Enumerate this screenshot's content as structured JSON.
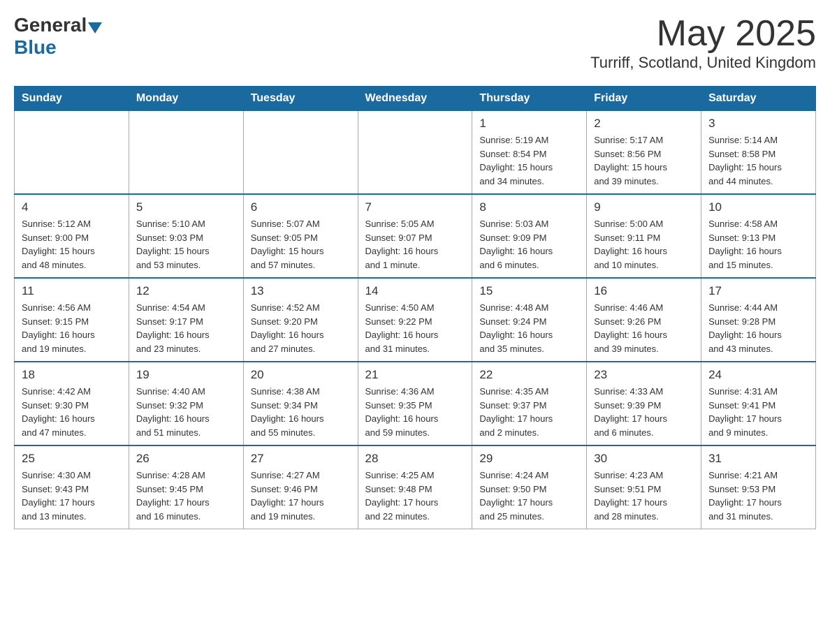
{
  "header": {
    "month_title": "May 2025",
    "location": "Turriff, Scotland, United Kingdom",
    "logo_general": "General",
    "logo_blue": "Blue"
  },
  "days_of_week": [
    "Sunday",
    "Monday",
    "Tuesday",
    "Wednesday",
    "Thursday",
    "Friday",
    "Saturday"
  ],
  "weeks": [
    [
      {
        "day": "",
        "info": ""
      },
      {
        "day": "",
        "info": ""
      },
      {
        "day": "",
        "info": ""
      },
      {
        "day": "",
        "info": ""
      },
      {
        "day": "1",
        "info": "Sunrise: 5:19 AM\nSunset: 8:54 PM\nDaylight: 15 hours\nand 34 minutes."
      },
      {
        "day": "2",
        "info": "Sunrise: 5:17 AM\nSunset: 8:56 PM\nDaylight: 15 hours\nand 39 minutes."
      },
      {
        "day": "3",
        "info": "Sunrise: 5:14 AM\nSunset: 8:58 PM\nDaylight: 15 hours\nand 44 minutes."
      }
    ],
    [
      {
        "day": "4",
        "info": "Sunrise: 5:12 AM\nSunset: 9:00 PM\nDaylight: 15 hours\nand 48 minutes."
      },
      {
        "day": "5",
        "info": "Sunrise: 5:10 AM\nSunset: 9:03 PM\nDaylight: 15 hours\nand 53 minutes."
      },
      {
        "day": "6",
        "info": "Sunrise: 5:07 AM\nSunset: 9:05 PM\nDaylight: 15 hours\nand 57 minutes."
      },
      {
        "day": "7",
        "info": "Sunrise: 5:05 AM\nSunset: 9:07 PM\nDaylight: 16 hours\nand 1 minute."
      },
      {
        "day": "8",
        "info": "Sunrise: 5:03 AM\nSunset: 9:09 PM\nDaylight: 16 hours\nand 6 minutes."
      },
      {
        "day": "9",
        "info": "Sunrise: 5:00 AM\nSunset: 9:11 PM\nDaylight: 16 hours\nand 10 minutes."
      },
      {
        "day": "10",
        "info": "Sunrise: 4:58 AM\nSunset: 9:13 PM\nDaylight: 16 hours\nand 15 minutes."
      }
    ],
    [
      {
        "day": "11",
        "info": "Sunrise: 4:56 AM\nSunset: 9:15 PM\nDaylight: 16 hours\nand 19 minutes."
      },
      {
        "day": "12",
        "info": "Sunrise: 4:54 AM\nSunset: 9:17 PM\nDaylight: 16 hours\nand 23 minutes."
      },
      {
        "day": "13",
        "info": "Sunrise: 4:52 AM\nSunset: 9:20 PM\nDaylight: 16 hours\nand 27 minutes."
      },
      {
        "day": "14",
        "info": "Sunrise: 4:50 AM\nSunset: 9:22 PM\nDaylight: 16 hours\nand 31 minutes."
      },
      {
        "day": "15",
        "info": "Sunrise: 4:48 AM\nSunset: 9:24 PM\nDaylight: 16 hours\nand 35 minutes."
      },
      {
        "day": "16",
        "info": "Sunrise: 4:46 AM\nSunset: 9:26 PM\nDaylight: 16 hours\nand 39 minutes."
      },
      {
        "day": "17",
        "info": "Sunrise: 4:44 AM\nSunset: 9:28 PM\nDaylight: 16 hours\nand 43 minutes."
      }
    ],
    [
      {
        "day": "18",
        "info": "Sunrise: 4:42 AM\nSunset: 9:30 PM\nDaylight: 16 hours\nand 47 minutes."
      },
      {
        "day": "19",
        "info": "Sunrise: 4:40 AM\nSunset: 9:32 PM\nDaylight: 16 hours\nand 51 minutes."
      },
      {
        "day": "20",
        "info": "Sunrise: 4:38 AM\nSunset: 9:34 PM\nDaylight: 16 hours\nand 55 minutes."
      },
      {
        "day": "21",
        "info": "Sunrise: 4:36 AM\nSunset: 9:35 PM\nDaylight: 16 hours\nand 59 minutes."
      },
      {
        "day": "22",
        "info": "Sunrise: 4:35 AM\nSunset: 9:37 PM\nDaylight: 17 hours\nand 2 minutes."
      },
      {
        "day": "23",
        "info": "Sunrise: 4:33 AM\nSunset: 9:39 PM\nDaylight: 17 hours\nand 6 minutes."
      },
      {
        "day": "24",
        "info": "Sunrise: 4:31 AM\nSunset: 9:41 PM\nDaylight: 17 hours\nand 9 minutes."
      }
    ],
    [
      {
        "day": "25",
        "info": "Sunrise: 4:30 AM\nSunset: 9:43 PM\nDaylight: 17 hours\nand 13 minutes."
      },
      {
        "day": "26",
        "info": "Sunrise: 4:28 AM\nSunset: 9:45 PM\nDaylight: 17 hours\nand 16 minutes."
      },
      {
        "day": "27",
        "info": "Sunrise: 4:27 AM\nSunset: 9:46 PM\nDaylight: 17 hours\nand 19 minutes."
      },
      {
        "day": "28",
        "info": "Sunrise: 4:25 AM\nSunset: 9:48 PM\nDaylight: 17 hours\nand 22 minutes."
      },
      {
        "day": "29",
        "info": "Sunrise: 4:24 AM\nSunset: 9:50 PM\nDaylight: 17 hours\nand 25 minutes."
      },
      {
        "day": "30",
        "info": "Sunrise: 4:23 AM\nSunset: 9:51 PM\nDaylight: 17 hours\nand 28 minutes."
      },
      {
        "day": "31",
        "info": "Sunrise: 4:21 AM\nSunset: 9:53 PM\nDaylight: 17 hours\nand 31 minutes."
      }
    ]
  ]
}
